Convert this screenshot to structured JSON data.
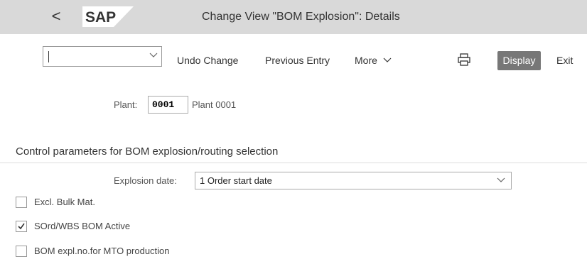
{
  "header": {
    "back_label": "<",
    "logo_text": "SAP",
    "title": "Change View \"BOM Explosion\": Details"
  },
  "toolbar": {
    "dropdown_value": "",
    "undo_label": "Undo Change",
    "previous_label": "Previous Entry",
    "more_label": "More",
    "display_label": "Display",
    "exit_label": "Exit"
  },
  "plant": {
    "label": "Plant:",
    "code": "0001",
    "name": "Plant 0001"
  },
  "section": {
    "title": "Control parameters for BOM explosion/routing selection"
  },
  "explosion": {
    "label": "Explosion date:",
    "value": "1 Order start date"
  },
  "options": [
    {
      "label": "Excl. Bulk Mat.",
      "checked": false
    },
    {
      "label": "SOrd/WBS BOM Active",
      "checked": true
    },
    {
      "label": "BOM expl.no.for MTO production",
      "checked": false
    }
  ]
}
